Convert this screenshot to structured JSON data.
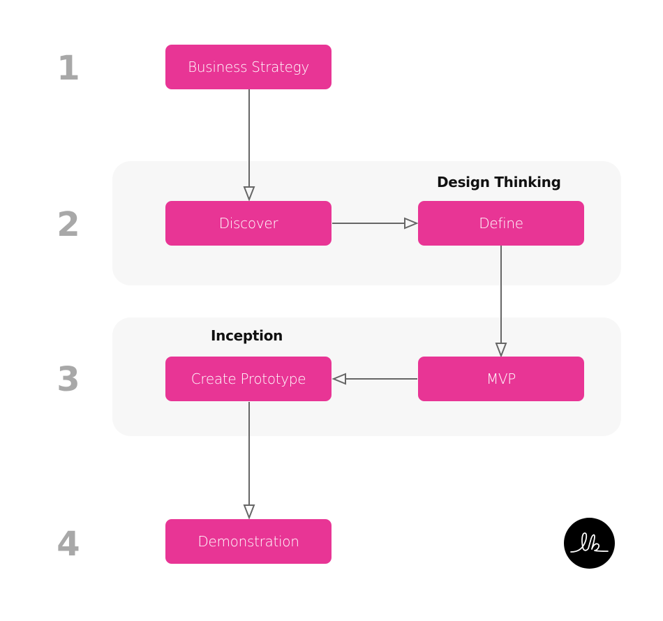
{
  "steps": [
    "1",
    "2",
    "3",
    "4"
  ],
  "groups": {
    "design_thinking": "Design Thinking",
    "inception": "Inception"
  },
  "nodes": {
    "business_strategy": "Business Strategy",
    "discover": "Discover",
    "define": "Define",
    "mvp": "MVP",
    "create_prototype": "Create Prototype",
    "demonstration": "Demonstration"
  },
  "edges": [
    {
      "from": "business_strategy",
      "to": "discover"
    },
    {
      "from": "discover",
      "to": "define"
    },
    {
      "from": "define",
      "to": "mvp"
    },
    {
      "from": "mvp",
      "to": "create_prototype"
    },
    {
      "from": "create_prototype",
      "to": "demonstration"
    }
  ],
  "colors": {
    "node": "#e83595",
    "group_bg": "#f7f7f7",
    "step_number": "#a8a8a8",
    "connector": "#666666"
  },
  "logo": {
    "text": "lb",
    "icon": "signature-logo-icon"
  }
}
